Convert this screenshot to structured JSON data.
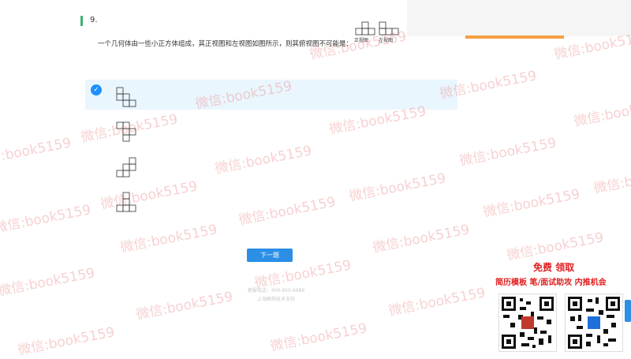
{
  "question": {
    "number": "9.",
    "text": "一个几何体由一些小正方体组成，其正视图和左视图如图所示，则其俯视图不可能是：",
    "view_labels": [
      "正视图",
      "左视图"
    ]
  },
  "options": [
    {
      "selected": true
    },
    {
      "selected": false
    },
    {
      "selected": false
    },
    {
      "selected": false
    }
  ],
  "next_button": "下一题",
  "footer": {
    "line1": "客服电话：400-850-6886",
    "line2": "上海鲸扬技术支持"
  },
  "watermark": "微信:book5159",
  "promo": {
    "line1": "免费 领取",
    "line2": "简历模板 笔/面试助攻 内推机会"
  },
  "colors": {
    "accent": "#2b8fe6",
    "check": "#1e90ff",
    "selected_bg": "#eaf6fd",
    "promo_red": "#e02020",
    "watermark": "#e66e6e"
  }
}
